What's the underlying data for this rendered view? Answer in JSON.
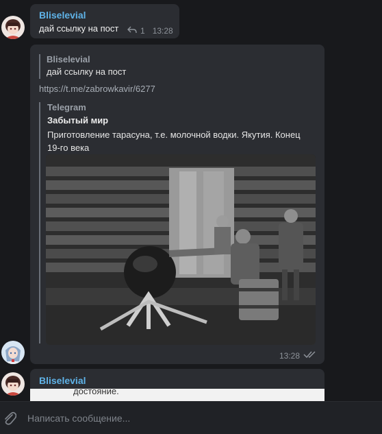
{
  "messages": [
    {
      "sender": "Bliselevial",
      "text": "дай ссылку на пост",
      "replies": "1",
      "time": "13:28"
    },
    {
      "quote": {
        "sender": "Bliselevial",
        "text": "дай ссылку на пост"
      },
      "link": "https://t.me/zabrowkavir/6277",
      "preview": {
        "site": "Telegram",
        "title": "Забытый мир",
        "description": "Приготовление тарасуна, т.е. молочной водки. Якутия. Конец 19-го века"
      },
      "time": "13:28"
    },
    {
      "sender": "Bliselevial",
      "snippet": "достояние."
    }
  ],
  "composer": {
    "placeholder": "Написать сообщение..."
  },
  "colors": {
    "accent": "#5fb3e8",
    "bubble": "#2b2d32",
    "background": "#18191c"
  }
}
